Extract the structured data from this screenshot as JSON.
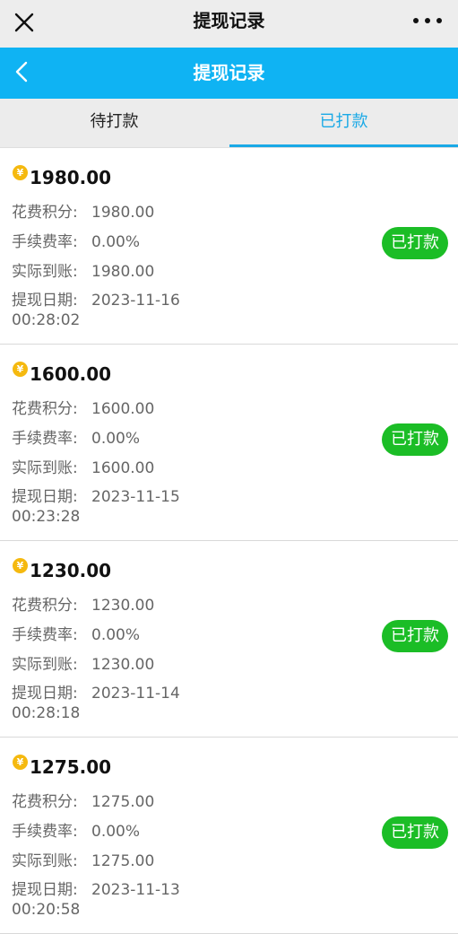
{
  "wechat_bar": {
    "title": "提现记录"
  },
  "header": {
    "title": "提现记录"
  },
  "tabs": [
    {
      "label": "待打款"
    },
    {
      "label": "已打款"
    }
  ],
  "colors": {
    "header_bg": "#0fb3f3",
    "active_tab": "#1aa9e6",
    "status_bg": "#1bbd26",
    "coin": "#f5b90f"
  },
  "labels": {
    "points": "花费积分:",
    "fee_rate": "手续费率:",
    "actual": "实际到账:",
    "date": "提现日期:"
  },
  "records": [
    {
      "amount": "1980.00",
      "points": "1980.00",
      "fee_rate": "0.00%",
      "actual": "1980.00",
      "date": "2023-11-16",
      "time": "00:28:02",
      "status": "已打款"
    },
    {
      "amount": "1600.00",
      "points": "1600.00",
      "fee_rate": "0.00%",
      "actual": "1600.00",
      "date": "2023-11-15",
      "time": "00:23:28",
      "status": "已打款"
    },
    {
      "amount": "1230.00",
      "points": "1230.00",
      "fee_rate": "0.00%",
      "actual": "1230.00",
      "date": "2023-11-14",
      "time": "00:28:18",
      "status": "已打款"
    },
    {
      "amount": "1275.00",
      "points": "1275.00",
      "fee_rate": "0.00%",
      "actual": "1275.00",
      "date": "2023-11-13",
      "time": "00:20:58",
      "status": "已打款"
    }
  ]
}
